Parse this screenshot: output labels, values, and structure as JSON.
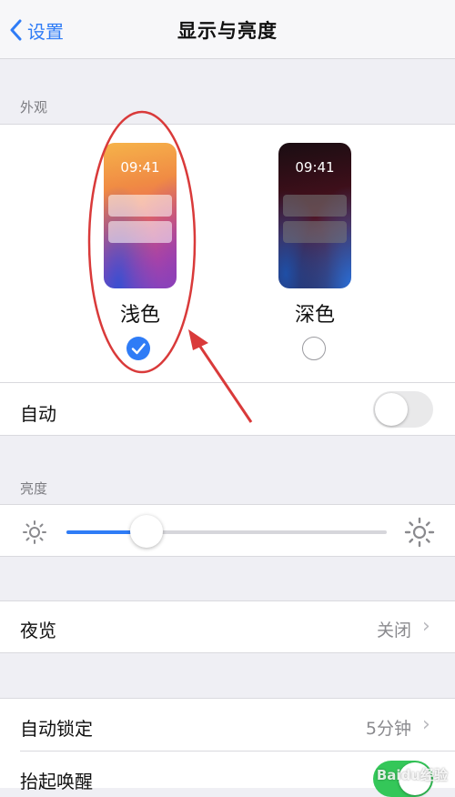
{
  "nav": {
    "back_label": "设置",
    "title": "显示与亮度"
  },
  "appearance": {
    "header": "外观",
    "light": {
      "label": "浅色",
      "time": "09:41",
      "selected": true
    },
    "dark": {
      "label": "深色",
      "time": "09:41",
      "selected": false
    },
    "auto": {
      "label": "自动",
      "enabled": false
    }
  },
  "brightness": {
    "header": "亮度",
    "level": 0.25
  },
  "night_shift": {
    "label": "夜览",
    "value": "关闭"
  },
  "auto_lock": {
    "label": "自动锁定",
    "value": "5分钟"
  },
  "raise_to_wake": {
    "label": "抬起唤醒",
    "enabled": true
  },
  "watermark": {
    "text": "Baidu经验"
  },
  "colors": {
    "accent": "#2f7cf6",
    "annotation_red": "#d93a3a",
    "toggle_on": "#34c759"
  }
}
